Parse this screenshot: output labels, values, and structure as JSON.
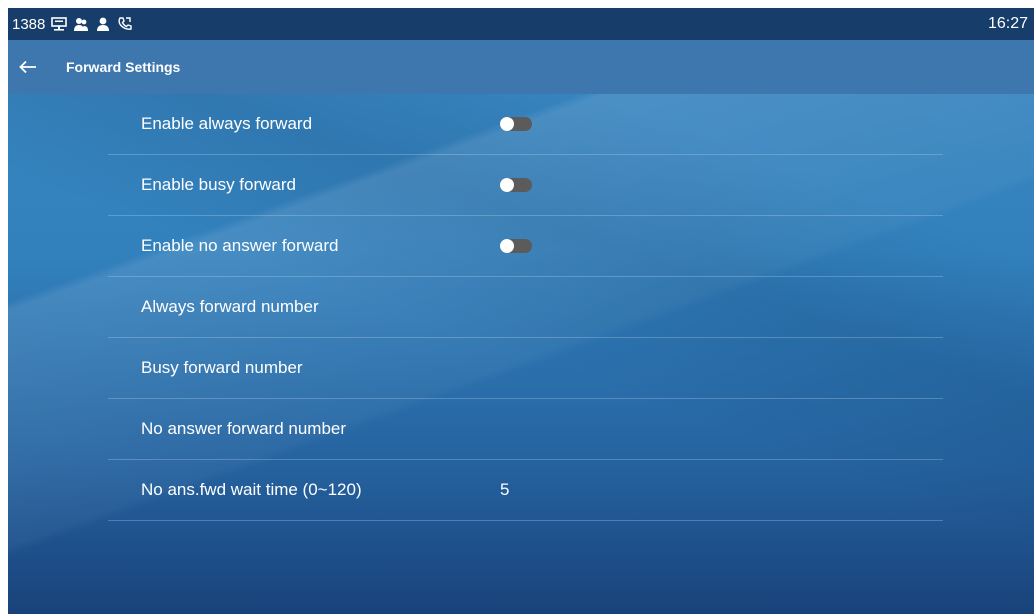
{
  "status_bar": {
    "account": "1388",
    "time": "16:27",
    "icons": [
      "network-icon",
      "contacts-icon",
      "user-icon",
      "call-forward-icon"
    ]
  },
  "header": {
    "title": "Forward Settings",
    "back_icon": "arrow-left-icon"
  },
  "settings": {
    "rows": [
      {
        "label": "Enable always forward",
        "type": "toggle",
        "on": false
      },
      {
        "label": "Enable busy forward",
        "type": "toggle",
        "on": false
      },
      {
        "label": "Enable no answer forward",
        "type": "toggle",
        "on": false
      },
      {
        "label": "Always forward number",
        "type": "text",
        "value": ""
      },
      {
        "label": "Busy forward number",
        "type": "text",
        "value": ""
      },
      {
        "label": "No answer forward number",
        "type": "text",
        "value": ""
      },
      {
        "label": "No ans.fwd wait time (0~120)",
        "type": "text",
        "value": "5"
      }
    ]
  },
  "colors": {
    "status_bar_bg": "#173d6b",
    "title_bar_bg": "#3d77ad",
    "background_top": "#3a86c0",
    "background_bottom": "#19427a",
    "toggle_off_track": "#5b5b5b",
    "toggle_knob": "#ffffff"
  }
}
